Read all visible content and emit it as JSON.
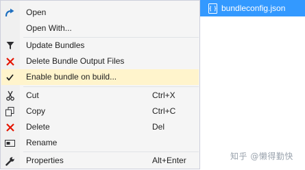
{
  "file_tab": {
    "name": "bundleconfig.json",
    "icon": "json-file-icon"
  },
  "menu": {
    "items": [
      {
        "label": "Open",
        "icon": "open-arrow-icon",
        "shortcut": ""
      },
      {
        "label": "Open With...",
        "icon": "",
        "shortcut": ""
      },
      {
        "label": "Update Bundles",
        "icon": "funnel-icon",
        "shortcut": ""
      },
      {
        "label": "Delete Bundle Output Files",
        "icon": "red-x-icon",
        "shortcut": ""
      },
      {
        "label": "Enable bundle on build...",
        "icon": "checkmark-icon",
        "shortcut": "",
        "highlighted": true
      },
      {
        "label": "Cut",
        "icon": "scissors-icon",
        "shortcut": "Ctrl+X"
      },
      {
        "label": "Copy",
        "icon": "copy-icon",
        "shortcut": "Ctrl+C"
      },
      {
        "label": "Delete",
        "icon": "red-x-icon",
        "shortcut": "Del"
      },
      {
        "label": "Rename",
        "icon": "rename-icon",
        "shortcut": ""
      },
      {
        "label": "Properties",
        "icon": "wrench-icon",
        "shortcut": "Alt+Enter"
      }
    ]
  },
  "watermark": "知乎 @懒得勤快",
  "colors": {
    "selection_blue": "#3399ff",
    "highlight": "#fff4cc",
    "open_icon_blue": "#1e6fbf",
    "delete_red": "#e51400"
  }
}
